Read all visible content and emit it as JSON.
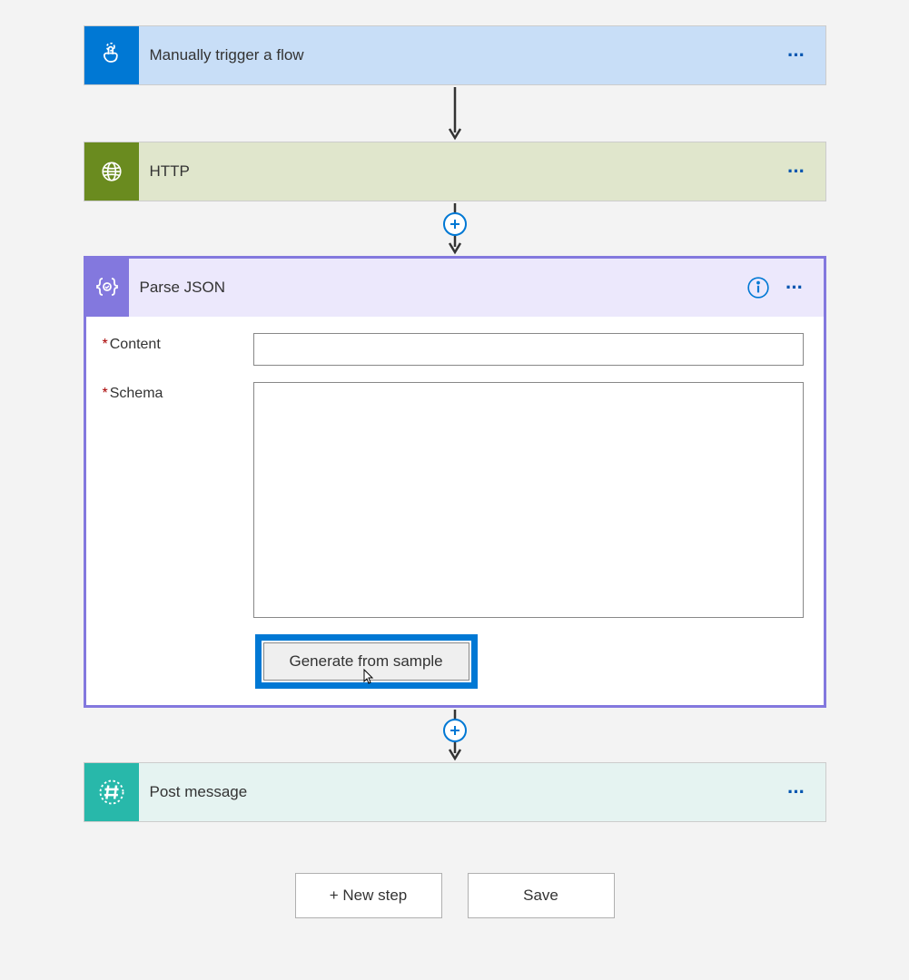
{
  "steps": {
    "trigger": {
      "title": "Manually trigger a flow"
    },
    "http": {
      "title": "HTTP"
    },
    "parse": {
      "title": "Parse JSON",
      "fields": {
        "content": {
          "label": "Content",
          "value": ""
        },
        "schema": {
          "label": "Schema",
          "value": ""
        }
      },
      "generate_button": "Generate from sample"
    },
    "post": {
      "title": "Post message"
    }
  },
  "bottom": {
    "new_step": "+ New step",
    "save": "Save"
  }
}
